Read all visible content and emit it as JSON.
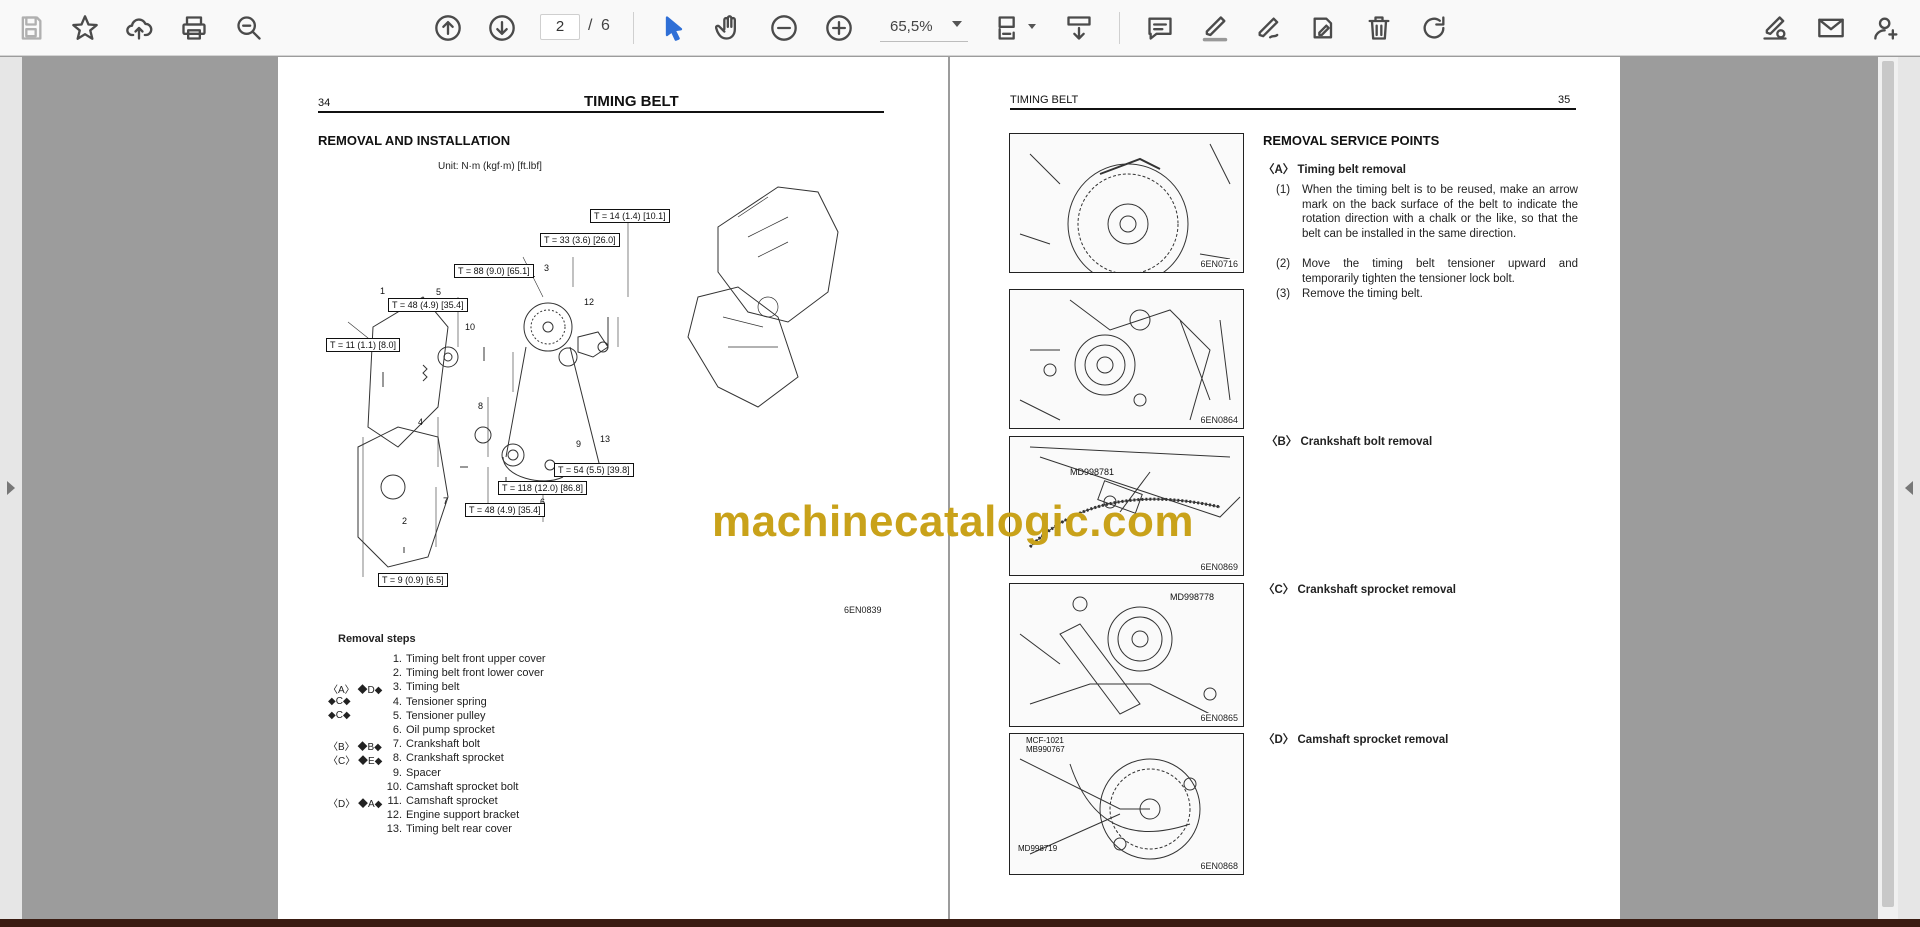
{
  "toolbar": {
    "page_current": "2",
    "page_separator": "/",
    "page_total": "6",
    "zoom": "65,5%",
    "icons": [
      "save-icon",
      "bookmark-star-icon",
      "upload-cloud-icon",
      "print-icon",
      "zoom-search-icon",
      "page-up-icon",
      "page-down-icon",
      "select-cursor-icon",
      "hand-pan-icon",
      "zoom-out-icon",
      "zoom-in-icon",
      "page-fit-icon",
      "scroll-mode-icon",
      "comment-icon",
      "highlight-pen-icon",
      "draw-pen-icon",
      "edit-stamp-icon",
      "delete-icon",
      "rotate-icon",
      "sign-icon",
      "email-icon",
      "add-user-icon"
    ]
  },
  "left_page": {
    "page_number": "34",
    "header_title": "TIMING BELT",
    "section_title": "REMOVAL AND INSTALLATION",
    "unit_note": "Unit: N·m (kgf·m) [ft.lbf]",
    "torque_labels": [
      "T = 14 (1.4) [10.1]",
      "T = 33 (3.6) [26.0]",
      "T = 88 (9.0) [65.1]",
      "T = 48 (4.9) [35.4]",
      "T = 11 (1.1) [8.0]",
      "T = 54 (5.5) [39.8]",
      "T = 118 (12.0) [86.8]",
      "T = 48 (4.9) [35.4]",
      "T = 9 (0.9) [6.5]"
    ],
    "figure_code": "6EN0839",
    "removal_steps_title": "Removal steps",
    "steps": [
      {
        "marks": "",
        "num": "1.",
        "text": "Timing belt front upper cover"
      },
      {
        "marks": "",
        "num": "2.",
        "text": "Timing belt front lower cover"
      },
      {
        "marks": "〈A〉  ◆D◆",
        "num": "3.",
        "text": "Timing belt"
      },
      {
        "marks": "◆C◆",
        "num": "4.",
        "text": "Tensioner spring"
      },
      {
        "marks": "◆C◆",
        "num": "5.",
        "text": "Tensioner pulley"
      },
      {
        "marks": "",
        "num": "6.",
        "text": "Oil pump sprocket"
      },
      {
        "marks": "〈B〉  ◆B◆",
        "num": "7.",
        "text": "Crankshaft bolt"
      },
      {
        "marks": "〈C〉  ◆E◆",
        "num": "8.",
        "text": "Crankshaft sprocket"
      },
      {
        "marks": "",
        "num": "9.",
        "text": "Spacer"
      },
      {
        "marks": "",
        "num": "10.",
        "text": "Camshaft sprocket bolt"
      },
      {
        "marks": "〈D〉  ◆A◆",
        "num": "11.",
        "text": "Camshaft sprocket"
      },
      {
        "marks": "",
        "num": "12.",
        "text": "Engine support bracket"
      },
      {
        "marks": "",
        "num": "13.",
        "text": "Timing belt rear cover"
      }
    ]
  },
  "right_page": {
    "header_title": "TIMING BELT",
    "page_number": "35",
    "section_title": "REMOVAL SERVICE POINTS",
    "point_a_title": "〈A〉  Timing belt removal",
    "point_a_steps": [
      {
        "num": "(1)",
        "text": "When the timing belt is to be reused, make an arrow mark on the back surface of the belt to indicate the rotation direction with a chalk or the like, so that the belt can be installed in the same direction."
      },
      {
        "num": "(2)",
        "text": "Move the timing belt tensioner upward and temporarily tighten the tensioner lock bolt."
      },
      {
        "num": "(3)",
        "text": "Remove the timing belt."
      }
    ],
    "point_b_title": "〈B〉  Crankshaft bolt removal",
    "point_c_title": "〈C〉  Crankshaft sprocket removal",
    "point_d_title": "〈D〉 Camshaft sprocket removal",
    "figure_codes": [
      "6EN0716",
      "6EN0864",
      "6EN0869",
      "6EN0865",
      "6EN0868"
    ],
    "tool_labels": {
      "fig3": "MD998781",
      "fig4": "MD998778",
      "fig5_top": "MCF-1021\nMB990767",
      "fig5_bottom": "MD998719"
    }
  },
  "watermark": "machinecatalogic.com"
}
